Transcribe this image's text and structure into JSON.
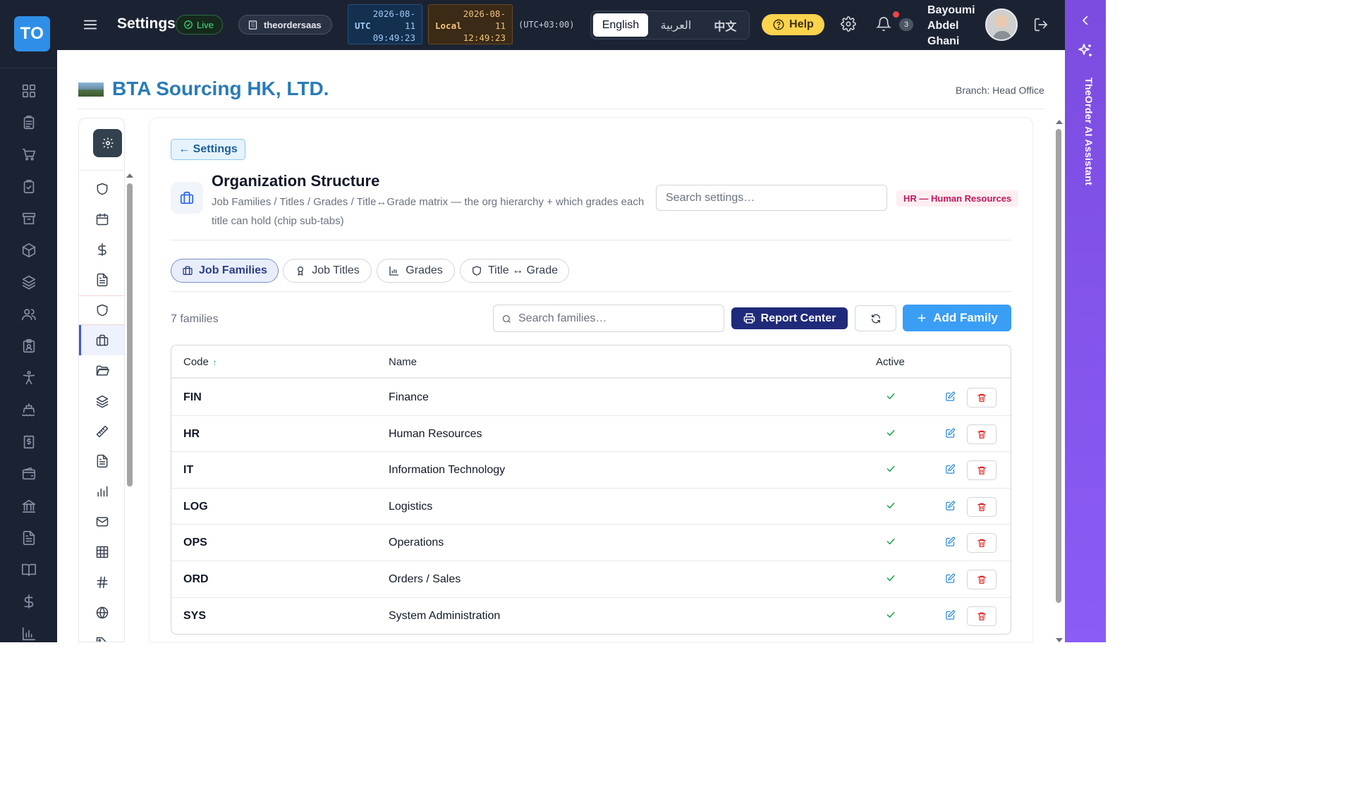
{
  "app": {
    "logo_text": "TO",
    "title": "Settings",
    "live_label": "Live",
    "tenant": "theordersaas",
    "clock_utc": {
      "label": "UTC",
      "date": "2026-08-11",
      "time": "09:49:23"
    },
    "clock_local": {
      "label": "Local",
      "date": "2026-08-11",
      "time": "12:49:23"
    },
    "timezone": "(UTC+03:00)",
    "languages": [
      "English",
      "العربية",
      "中文"
    ],
    "active_language": "English",
    "help_label": "Help",
    "notification_count": "3",
    "user_name": "Bayoumi Abdel Ghani"
  },
  "ai_assistant": {
    "label": "TheOrder AI Assistant"
  },
  "page": {
    "company": "BTA Sourcing HK, LTD.",
    "branch": "Branch: Head Office"
  },
  "section": {
    "back_label": "← Settings",
    "title": "Organization Structure",
    "description": "Job Families / Titles / Grades / Title↔Grade matrix — the org hierarchy + which grades each title can hold (chip sub-tabs)",
    "search_placeholder": "Search settings…",
    "module_badge": "HR — Human Resources"
  },
  "tabs": [
    {
      "label": "Job Families",
      "icon": "briefcase-icon",
      "active": true
    },
    {
      "label": "Job Titles",
      "icon": "award-icon",
      "active": false
    },
    {
      "label": "Grades",
      "icon": "bar-chart-icon",
      "active": false
    },
    {
      "label": "Title ↔ Grade",
      "icon": "shield-icon",
      "active": false
    }
  ],
  "toolbar": {
    "count_label": "7 families",
    "search_placeholder": "Search families…",
    "report_label": "Report Center",
    "add_label": "Add Family"
  },
  "table": {
    "columns": {
      "code": "Code",
      "name": "Name",
      "active": "Active"
    },
    "sort_column": "code",
    "sort_direction": "asc",
    "rows": [
      {
        "code": "FIN",
        "name": "Finance",
        "active": true
      },
      {
        "code": "HR",
        "name": "Human Resources",
        "active": true
      },
      {
        "code": "IT",
        "name": "Information Technology",
        "active": true
      },
      {
        "code": "LOG",
        "name": "Logistics",
        "active": true
      },
      {
        "code": "OPS",
        "name": "Operations",
        "active": true
      },
      {
        "code": "ORD",
        "name": "Orders / Sales",
        "active": true
      },
      {
        "code": "SYS",
        "name": "System Administration",
        "active": true
      }
    ]
  },
  "colors": {
    "topbar_bg": "#1b2333",
    "brand_blue": "#2f8fe8",
    "company_blue": "#2a7bb8",
    "report_navy": "#1f2a7a",
    "add_blue": "#3b9ef5",
    "help_yellow": "#fcd34d",
    "ai_purple": "#8b5cf6",
    "active_green": "#16a34a",
    "delete_red": "#dc2626"
  },
  "rail_icons": [
    "dashboard-icon",
    "clipboard-icon",
    "cart-icon",
    "clipboard-check-icon",
    "archive-icon",
    "package-icon",
    "layers-icon",
    "users-icon",
    "id-badge-icon",
    "accessibility-icon",
    "ship-icon",
    "invoice-icon",
    "wallet-icon",
    "bank-icon",
    "document-icon",
    "book-icon",
    "dollar-icon",
    "chart-icon"
  ],
  "subnav_icons": [
    "shield-icon",
    "calendar-icon",
    "dollar-icon",
    "document-icon",
    "shield-icon",
    "briefcase-icon",
    "folder-icon",
    "layers-icon",
    "ruler-icon",
    "document-icon",
    "bar-chart-icon",
    "mail-icon",
    "grid-icon",
    "hash-icon",
    "globe-icon",
    "tag-icon"
  ]
}
